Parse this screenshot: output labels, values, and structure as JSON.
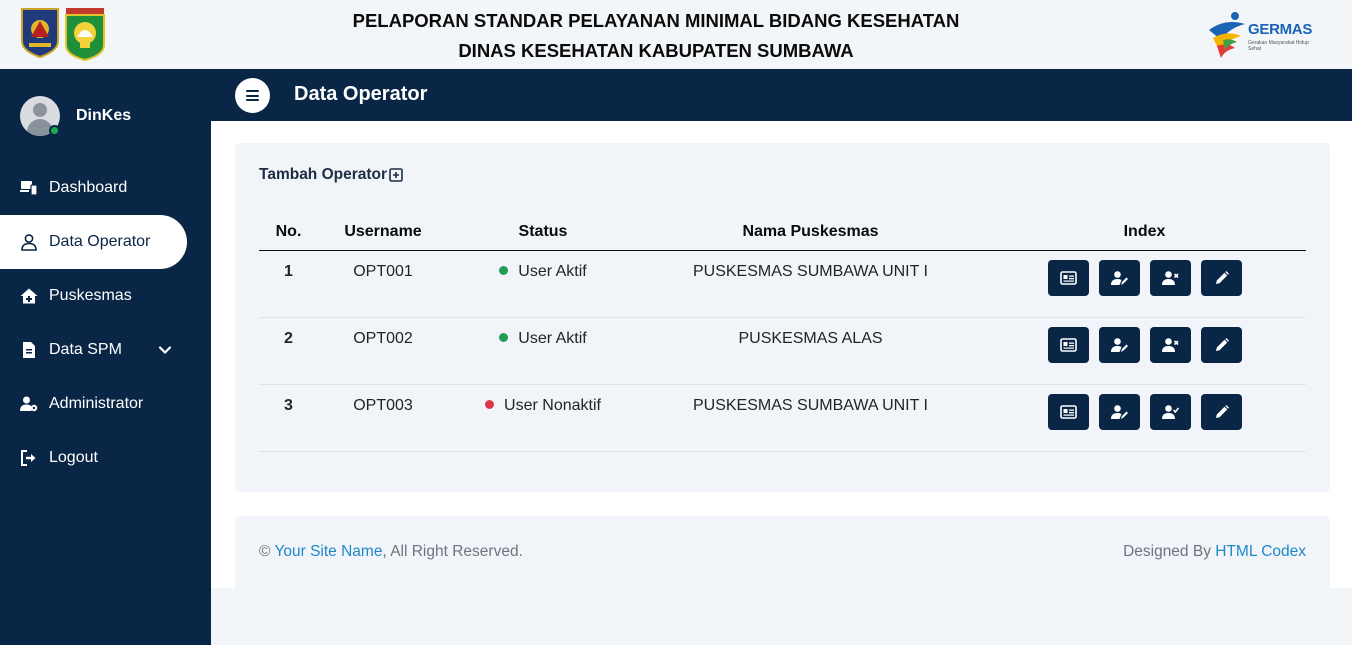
{
  "header": {
    "title_line1": "PELAPORAN STANDAR PELAYANAN MINIMAL BIDANG KESEHATAN",
    "title_line2": "DINAS KESEHATAN KABUPATEN SUMBAWA",
    "germas_logo_text": "GERMAS",
    "germas_logo_tagline": "Gerakan Masyarakat Hidup Sehat"
  },
  "sidebar": {
    "user_name": "DinKes",
    "items": [
      {
        "label": "Dashboard",
        "icon": "dashboard-icon"
      },
      {
        "label": "Data Operator",
        "icon": "user-icon",
        "active": true
      },
      {
        "label": "Puskesmas",
        "icon": "house-icon"
      },
      {
        "label": "Data SPM",
        "icon": "file-icon",
        "has_dropdown": true
      },
      {
        "label": "Administrator",
        "icon": "users-gear-icon"
      },
      {
        "label": "Logout",
        "icon": "logout-icon"
      }
    ]
  },
  "page": {
    "title": "Data Operator",
    "add_label": "Tambah Operator"
  },
  "table": {
    "headers": [
      "No.",
      "Username",
      "Status",
      "Nama Puskesmas",
      "Index"
    ],
    "rows": [
      {
        "no": "1",
        "username": "OPT001",
        "status": "User Aktif",
        "status_color": "#1e9e54",
        "puskesmas": "PUSKESMAS SUMBAWA UNIT I",
        "toggle_icon": "user-remove-icon"
      },
      {
        "no": "2",
        "username": "OPT002",
        "status": "User Aktif",
        "status_color": "#1e9e54",
        "puskesmas": "PUSKESMAS ALAS",
        "toggle_icon": "user-remove-icon"
      },
      {
        "no": "3",
        "username": "OPT003",
        "status": "User Nonaktif",
        "status_color": "#dc3545",
        "puskesmas": "PUSKESMAS SUMBAWA UNIT I",
        "toggle_icon": "user-check-icon"
      }
    ]
  },
  "footer": {
    "copyright_symbol": "©",
    "site_name": "Your Site Name",
    "rights": ", All Right Reserved.",
    "designed_by": "Designed By ",
    "designer": "HTML Codex"
  },
  "colors": {
    "navy": "#0a2646",
    "active_status": "#1e9e54",
    "inactive_status": "#dc3545",
    "link": "#1e88c9"
  }
}
